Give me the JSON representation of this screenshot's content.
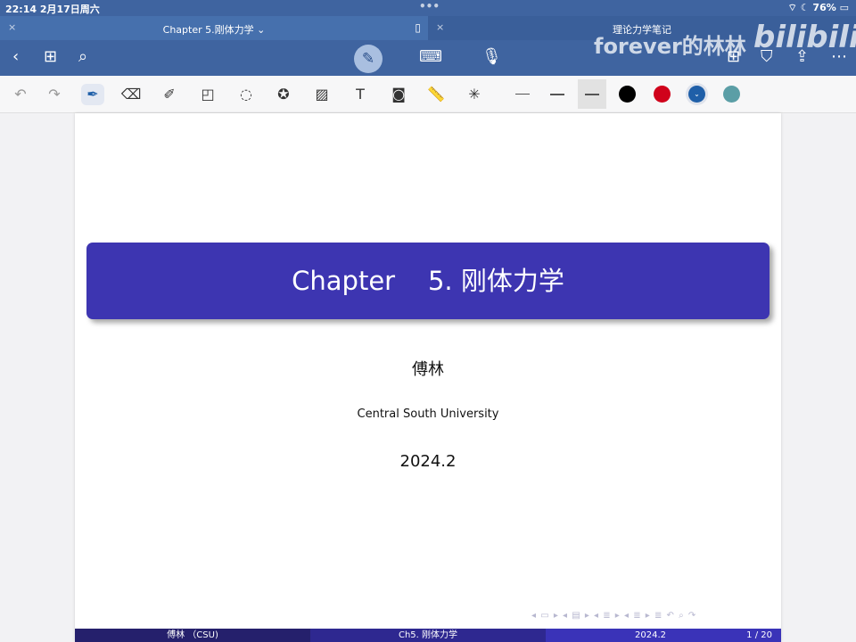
{
  "status": {
    "time": "22:14  2月17日周六",
    "battery": "76%",
    "indicators": "wifi moon"
  },
  "tabs": [
    {
      "label": "Chapter 5.刚体力学 ⌄",
      "close": "×"
    },
    {
      "label": "理论力学笔记",
      "close": "×"
    }
  ],
  "watermark": {
    "text": "forever的林林",
    "logo": "bilibili"
  },
  "toolbar": {
    "colors": [
      "#000000",
      "#d0021b",
      "#1f5fa8",
      "#5b9ea6"
    ],
    "selected_color": "#1f5fa8"
  },
  "slide": {
    "title": "Chapter    5. 刚体力学",
    "author": "傅林",
    "institute": "Central South University",
    "date": "2024.2",
    "footer": {
      "left": "傅林 （CSU)",
      "middle": "Ch5. 刚体力学",
      "date": "2024.2",
      "page": "1 / 20"
    },
    "nav_symbols": "◂ ▭ ▸  ◂ ▤ ▸  ◂ ≣ ▸  ◂ ≣ ▸   ≣   ↶ ⌕ ↷"
  }
}
